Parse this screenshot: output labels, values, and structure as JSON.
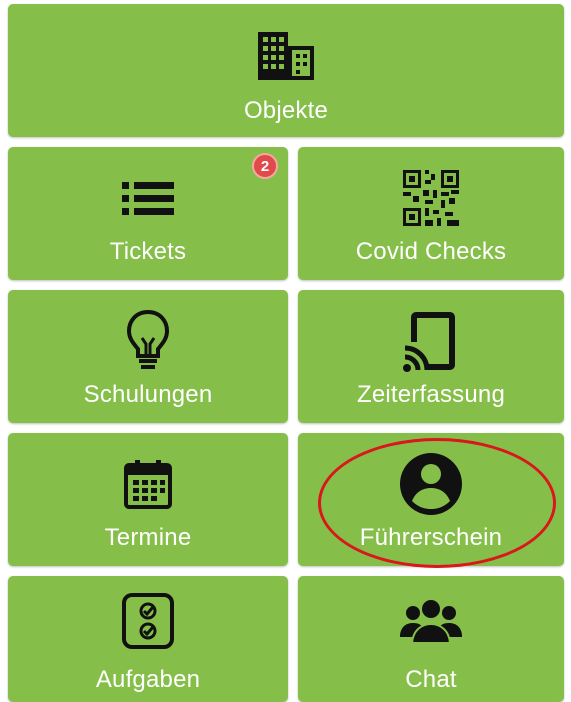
{
  "colors": {
    "tile_bg": "#85bf49",
    "label": "#ffffff",
    "icon": "#111111",
    "badge": "#e04a4a",
    "highlight": "#d9171c"
  },
  "tiles": {
    "objekte": {
      "label": "Objekte",
      "icon": "building-icon"
    },
    "tickets": {
      "label": "Tickets",
      "icon": "list-icon",
      "badge": "2"
    },
    "covid_checks": {
      "label": "Covid Checks",
      "icon": "qr-code-icon"
    },
    "schulungen": {
      "label": "Schulungen",
      "icon": "lightbulb-icon"
    },
    "zeiterfassung": {
      "label": "Zeiterfassung",
      "icon": "cast-tablet-icon"
    },
    "termine": {
      "label": "Termine",
      "icon": "calendar-icon"
    },
    "fuehrerschein": {
      "label": "Führerschein",
      "icon": "account-circle-icon"
    },
    "aufgaben": {
      "label": "Aufgaben",
      "icon": "checklist-icon"
    },
    "chat": {
      "label": "Chat",
      "icon": "group-chat-icon"
    }
  }
}
